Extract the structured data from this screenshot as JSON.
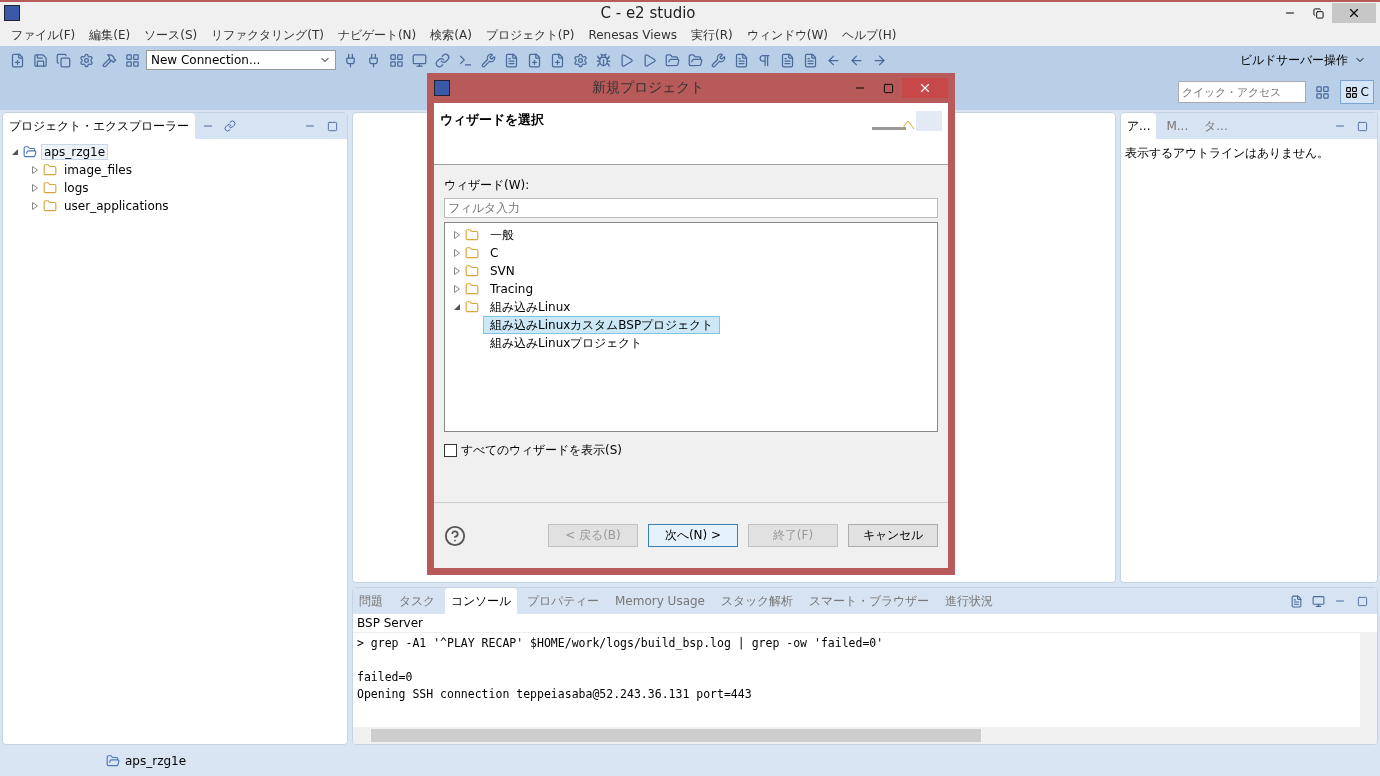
{
  "window": {
    "title": "C - e2 studio"
  },
  "menu": [
    "ファイル(F)",
    "編集(E)",
    "ソース(S)",
    "リファクタリング(T)",
    "ナビゲート(N)",
    "検索(A)",
    "プロジェクト(P)",
    "Renesas Views",
    "実行(R)",
    "ウィンドウ(W)",
    "ヘルプ(H)"
  ],
  "toolbar": {
    "connection": "New Connection...",
    "build_server": "ビルドサーバー操作",
    "quick_access": {
      "placeholder": "クイック・アクセス"
    },
    "perspective": {
      "label": "C",
      "selected": true
    }
  },
  "explorer": {
    "tab": "プロジェクト・エクスプローラー",
    "tree": [
      {
        "label": "aps_rzg1e",
        "kind": "project",
        "expanded": true,
        "selected": true,
        "children": [
          {
            "label": "image_files",
            "kind": "folder",
            "expanded": false,
            "selected": false
          },
          {
            "label": "logs",
            "kind": "folder",
            "expanded": false,
            "selected": false
          },
          {
            "label": "user_applications",
            "kind": "folder",
            "expanded": false,
            "selected": false
          }
        ]
      }
    ]
  },
  "outline": {
    "tabs": [
      {
        "label": "ア...",
        "selected": true
      },
      {
        "label": "M...",
        "selected": false
      },
      {
        "label": "タ...",
        "selected": false
      }
    ],
    "message": "表示するアウトラインはありません。"
  },
  "console": {
    "tabs": [
      {
        "label": "問題",
        "selected": false
      },
      {
        "label": "タスク",
        "selected": false
      },
      {
        "label": "コンソール",
        "selected": true
      },
      {
        "label": "プロパティー",
        "selected": false
      },
      {
        "label": "Memory Usage",
        "selected": false
      },
      {
        "label": "スタック解析",
        "selected": false
      },
      {
        "label": "スマート・ブラウザー",
        "selected": false
      },
      {
        "label": "進行状況",
        "selected": false
      }
    ],
    "title": "BSP Server",
    "blocks": [
      [
        "> grep -A1 '^PLAY RECAP' $HOME/work/logs/build_bsp.log | grep -ow 'failed=0'"
      ],
      [
        "failed=0",
        "Opening SSH connection teppeiasaba@52.243.36.131 port=443"
      ]
    ]
  },
  "status_bar": {
    "project": "aps_rzg1e"
  },
  "dialog": {
    "title": "新規プロジェクト",
    "heading": "ウィザードを選択",
    "wizard_label": "ウィザード(W):",
    "filter": {
      "placeholder": "フィルタ入力"
    },
    "tree": [
      {
        "label": "一般",
        "expanded": false,
        "selected": false
      },
      {
        "label": "C",
        "expanded": false,
        "selected": false
      },
      {
        "label": "SVN",
        "expanded": false,
        "selected": false
      },
      {
        "label": "Tracing",
        "expanded": false,
        "selected": false
      },
      {
        "label": "組み込みLinux",
        "expanded": true,
        "selected": false,
        "children": [
          {
            "label": "組み込みLinuxカスタムBSPプロジェクト",
            "selected": true
          },
          {
            "label": "組み込みLinuxプロジェクト",
            "selected": false
          }
        ]
      }
    ],
    "show_all": {
      "label": "すべてのウィザードを表示(S)",
      "checked": false
    },
    "buttons": [
      {
        "label": "< 戻る(B)",
        "disabled": true,
        "default": false
      },
      {
        "label": "次へ(N) >",
        "disabled": false,
        "default": true
      },
      {
        "label": "終了(F)",
        "disabled": true,
        "default": false
      },
      {
        "label": "キャンセル",
        "disabled": false,
        "default": false
      }
    ]
  }
}
